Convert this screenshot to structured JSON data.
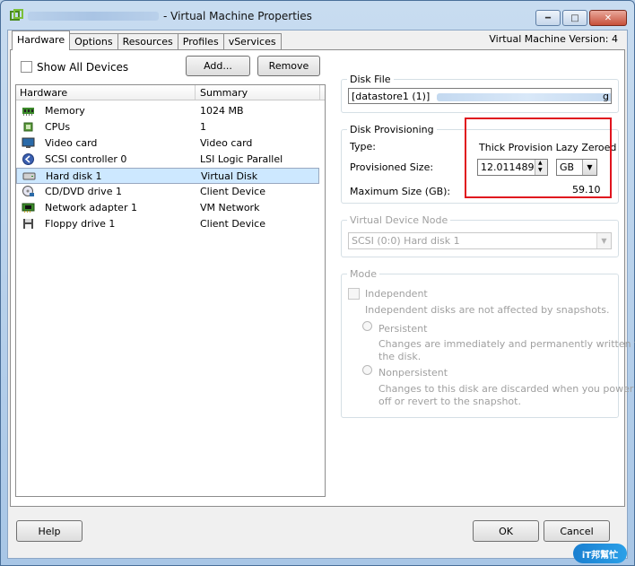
{
  "window": {
    "title": "- Virtual Machine Properties",
    "vm_version": "Virtual Machine Version: 4"
  },
  "tabs": [
    {
      "label": "Hardware",
      "active": true
    },
    {
      "label": "Options",
      "active": false
    },
    {
      "label": "Resources",
      "active": false
    },
    {
      "label": "Profiles",
      "active": false
    },
    {
      "label": "vServices",
      "active": false
    }
  ],
  "hardware": {
    "show_all_devices_label": "Show All Devices",
    "add_label": "Add...",
    "remove_label": "Remove",
    "columns": {
      "hardware": "Hardware",
      "summary": "Summary"
    },
    "devices": [
      {
        "name": "Memory",
        "summary": "1024 MB",
        "icon": "memory-icon"
      },
      {
        "name": "CPUs",
        "summary": "1",
        "icon": "cpu-icon"
      },
      {
        "name": "Video card",
        "summary": "Video card",
        "icon": "monitor-icon"
      },
      {
        "name": "SCSI controller 0",
        "summary": "LSI Logic Parallel",
        "icon": "scsi-controller-icon"
      },
      {
        "name": "Hard disk 1",
        "summary": "Virtual Disk",
        "icon": "hard-disk-icon",
        "selected": true
      },
      {
        "name": "CD/DVD drive 1",
        "summary": "Client Device",
        "icon": "cd-dvd-icon"
      },
      {
        "name": "Network adapter 1",
        "summary": "VM Network",
        "icon": "network-adapter-icon"
      },
      {
        "name": "Floppy drive 1",
        "summary": "Client Device",
        "icon": "floppy-icon"
      }
    ]
  },
  "disk_file": {
    "legend": "Disk File",
    "value": "[datastore1 (1)]",
    "value_tail": "g"
  },
  "disk_provisioning": {
    "legend": "Disk Provisioning",
    "type_label": "Type:",
    "type_value": "Thick Provision Lazy Zeroed",
    "provisioned_label": "Provisioned Size:",
    "provisioned_value": "12.0114898",
    "unit": "GB",
    "max_label": "Maximum Size (GB):",
    "max_value": "59.10"
  },
  "virtual_device_node": {
    "legend": "Virtual Device Node",
    "value": "SCSI (0:0) Hard disk 1"
  },
  "mode": {
    "legend": "Mode",
    "independent_label": "Independent",
    "independent_desc": "Independent disks are not affected by snapshots.",
    "persistent_label": "Persistent",
    "persistent_desc_1": "Changes are immediately and permanently written to",
    "persistent_desc_2": "the disk.",
    "nonpersistent_label": "Nonpersistent",
    "nonpersistent_desc_1": "Changes to this disk are discarded when you power",
    "nonpersistent_desc_2": "off or revert to the snapshot."
  },
  "footer": {
    "help_label": "Help",
    "ok_label": "OK",
    "cancel_label": "Cancel"
  },
  "watermark": {
    "text": "iT邦幫忙"
  },
  "colors": {
    "highlight_box": "#e0141e",
    "selection": "#cde8ff",
    "titlebar": "#b9d1ea"
  }
}
